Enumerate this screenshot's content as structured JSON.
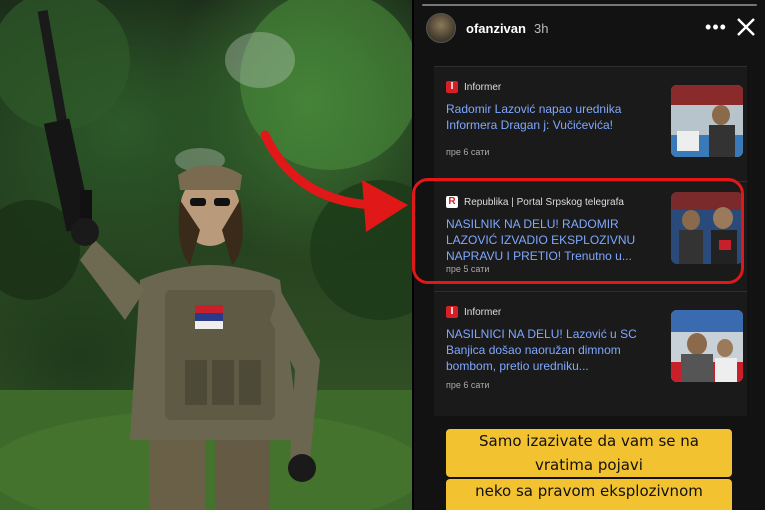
{
  "story": {
    "username": "ofanzivan",
    "time": "3h",
    "more_icon": "more-horizontal-icon",
    "close_icon": "close-icon"
  },
  "news": [
    {
      "source_logo": "I",
      "source": "Informer",
      "headline": "Radomir Lazović napao urednika Informera Dragan j: Vučićevića!",
      "age": "пре 6 сати",
      "logo_color": "#d81f26"
    },
    {
      "source_logo": "R",
      "source": "Republika | Portal Srpskog telegrafa",
      "headline": "NASILNIK NA DELU! RADOMIR LAZOVIĆ IZVADIO EKSPLOZIVNU NAPRAVU I PRETIO! Trenutno u...",
      "age": "пре 5 сати",
      "logo_color": "#ffffff"
    },
    {
      "source_logo": "I",
      "source": "Informer",
      "headline": "NASILNICI NA DELU! Lazović u SC Banjica došao naoružan dimnom bombom, pretio uredniku...",
      "age": "пре 6 сати",
      "logo_color": "#d81f26"
    }
  ],
  "caption": {
    "line1": "Samo izazivate da vam se na vratima pojavi",
    "line2": "neko sa pravom eksplozivnom napravom"
  },
  "colors": {
    "highlight": "#e01818",
    "caption_bg": "#f2c230",
    "link": "#7fa8ff"
  }
}
